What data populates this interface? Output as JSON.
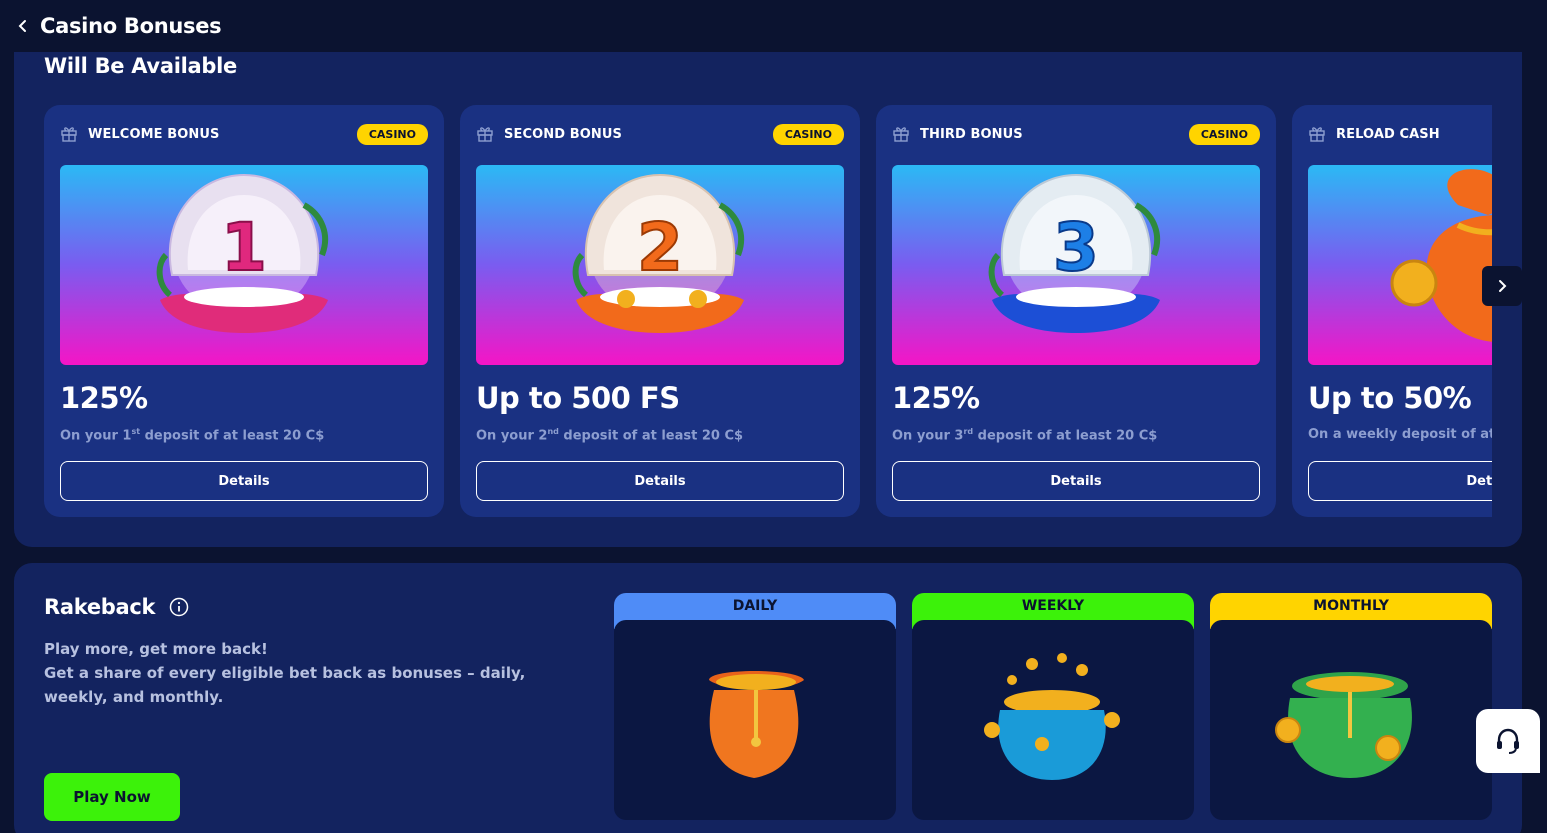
{
  "header": {
    "title": "Casino Bonuses"
  },
  "available": {
    "title": "Will Be Available",
    "cards": [
      {
        "type": "WELCOME BONUS",
        "badge": "CASINO",
        "amount": "125%",
        "desc_pre": "On your 1",
        "desc_sup": "st",
        "desc_post": " deposit of at least 20 C$",
        "button": "Details",
        "image_number": "1"
      },
      {
        "type": "SECOND BONUS",
        "badge": "CASINO",
        "amount": "Up to 500 FS",
        "desc_pre": "On your 2",
        "desc_sup": "nd",
        "desc_post": " deposit of at least 20 C$",
        "button": "Details",
        "image_number": "2"
      },
      {
        "type": "THIRD BONUS",
        "badge": "CASINO",
        "amount": "125%",
        "desc_pre": "On your 3",
        "desc_sup": "rd",
        "desc_post": " deposit of at least 20 C$",
        "button": "Details",
        "image_number": "3"
      },
      {
        "type": "RELOAD CASH",
        "badge": "",
        "amount": "Up to 50%",
        "desc_pre": "On a weekly deposit of at",
        "desc_sup": "",
        "desc_post": "",
        "button": "Details",
        "image_number": ""
      }
    ]
  },
  "rakeback": {
    "title": "Rakeback",
    "line1": "Play more, get more back!",
    "line2": "Get a share of every eligible bet back as bonuses – daily, weekly, and monthly.",
    "play_button": "Play Now",
    "tabs": [
      {
        "label": "DAILY",
        "color": "#4f8cf7"
      },
      {
        "label": "WEEKLY",
        "color": "#3cf20a"
      },
      {
        "label": "MONTHLY",
        "color": "#ffd400"
      }
    ]
  },
  "icons": {
    "back": "chevron-left-icon",
    "gift": "gift-icon",
    "next": "chevron-right-icon",
    "info": "info-icon",
    "support": "headset-icon"
  },
  "colors": {
    "background": "#0b1330",
    "panel": "#13235f",
    "card": "#1a3182",
    "badge": "#ffd400",
    "play_button": "#3cf20a"
  }
}
